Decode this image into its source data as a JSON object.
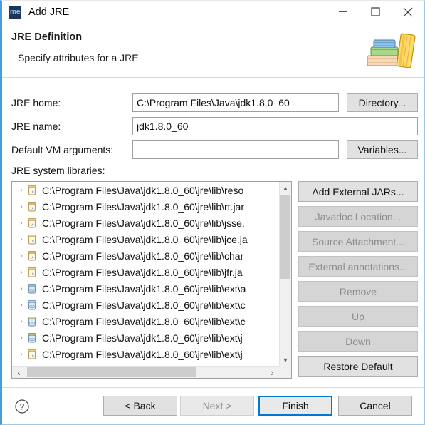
{
  "window": {
    "title": "Add JRE",
    "icon": "myeclipse-icon",
    "icon_text": "me",
    "accent_color": "#4a9ed8",
    "controls": [
      {
        "name": "minimize-button",
        "glyph": "minimize-icon"
      },
      {
        "name": "maximize-button",
        "glyph": "maximize-icon"
      },
      {
        "name": "close-button",
        "glyph": "close-icon"
      }
    ]
  },
  "header": {
    "title": "JRE Definition",
    "subtitle": "Specify attributes for a JRE",
    "art_icon": "books-stack-icon"
  },
  "form": {
    "jre_home": {
      "label": "JRE home:",
      "value": "C:\\Program Files\\Java\\jdk1.8.0_60",
      "placeholder": "",
      "button": "Directory..."
    },
    "jre_name": {
      "label": "JRE name:",
      "value": "jdk1.8.0_60",
      "placeholder": ""
    },
    "vm_args": {
      "label": "Default VM arguments:",
      "value": "",
      "placeholder": "",
      "button": "Variables..."
    }
  },
  "libraries": {
    "label": "JRE system libraries:",
    "items": [
      {
        "text": "C:\\Program Files\\Java\\jdk1.8.0_60\\jre\\lib\\reso",
        "icon": "jar-icon"
      },
      {
        "text": "C:\\Program Files\\Java\\jdk1.8.0_60\\jre\\lib\\rt.jar",
        "icon": "jar-icon"
      },
      {
        "text": "C:\\Program Files\\Java\\jdk1.8.0_60\\jre\\lib\\jsse.",
        "icon": "jar-icon"
      },
      {
        "text": "C:\\Program Files\\Java\\jdk1.8.0_60\\jre\\lib\\jce.ja",
        "icon": "jar-icon"
      },
      {
        "text": "C:\\Program Files\\Java\\jdk1.8.0_60\\jre\\lib\\char",
        "icon": "jar-icon"
      },
      {
        "text": "C:\\Program Files\\Java\\jdk1.8.0_60\\jre\\lib\\jfr.ja",
        "icon": "jar-icon"
      },
      {
        "text": "C:\\Program Files\\Java\\jdk1.8.0_60\\jre\\lib\\ext\\a",
        "icon": "binary-jar-icon"
      },
      {
        "text": "C:\\Program Files\\Java\\jdk1.8.0_60\\jre\\lib\\ext\\c",
        "icon": "binary-jar-icon"
      },
      {
        "text": "C:\\Program Files\\Java\\jdk1.8.0_60\\jre\\lib\\ext\\c",
        "icon": "binary-jar-icon"
      },
      {
        "text": "C:\\Program Files\\Java\\jdk1.8.0_60\\jre\\lib\\ext\\j",
        "icon": "binary-jar-icon"
      },
      {
        "text": "C:\\Program Files\\Java\\jdk1.8.0_60\\jre\\lib\\ext\\j",
        "icon": "jar-icon"
      }
    ],
    "expander_glyph": "›",
    "side_buttons": [
      {
        "label": "Add External JARs...",
        "enabled": true
      },
      {
        "label": "Javadoc Location...",
        "enabled": false
      },
      {
        "label": "Source Attachment...",
        "enabled": false
      },
      {
        "label": "External annotations...",
        "enabled": false
      },
      {
        "label": "Remove",
        "enabled": false
      },
      {
        "label": "Up",
        "enabled": false
      },
      {
        "label": "Down",
        "enabled": false
      },
      {
        "label": "Restore Default",
        "enabled": true
      }
    ]
  },
  "footer": {
    "help_icon": "help-question-icon",
    "buttons": [
      {
        "label": "< Back",
        "enabled": true,
        "default": false
      },
      {
        "label": "Next >",
        "enabled": false,
        "default": false
      },
      {
        "label": "Finish",
        "enabled": true,
        "default": true
      },
      {
        "label": "Cancel",
        "enabled": true,
        "default": false
      }
    ]
  }
}
